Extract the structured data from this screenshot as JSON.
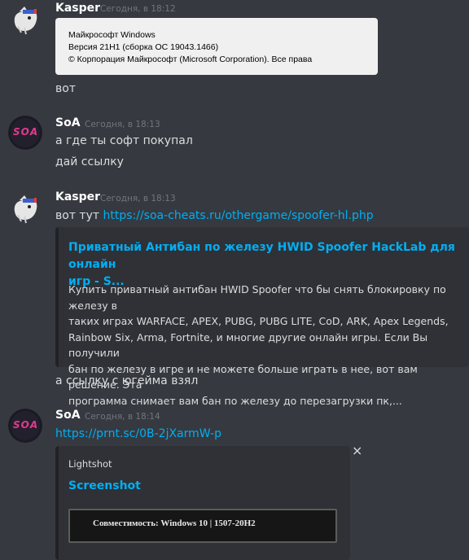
{
  "messages": [
    {
      "author": "Kasper",
      "time": "Сегодня, в 18:12",
      "screenshot_lines": [
        "Майкрософт Windows",
        "Версия 21H1 (сборка ОС 19043.1466)",
        "© Корпорация Майкрософт (Microsoft Corporation). Все права"
      ],
      "text": "вот"
    },
    {
      "author": "SoA",
      "time": "Сегодня, в 18:13",
      "lines": [
        "а где ты софт покупал",
        "дай ссылку"
      ]
    },
    {
      "author": "Kasper",
      "time": "Сегодня, в 18:13",
      "prefix": "вот тут ",
      "link": "https://soa-cheats.ru/othergame/spoofer-hl.php",
      "embed": {
        "title_lines": [
          "Приватный Антибан по железу HWID Spoofer HackLab для онлайн",
          "игр - S..."
        ],
        "description_lines": [
          "Купить приватный антибан HWID Spoofer что бы снять блокировку по железу в",
          "таких играх WARFACE, APEX, PUBG, PUBG LITE, CoD, ARK, Apex Legends,",
          "Rainbow Six, Arma, Fortnite, и многие другие онлайн игры. Если Вы получили",
          "бан по железу в игре и не можете больше играть в нее, вот вам решение. Эта",
          "программа снимает вам бан по железу до перезагрузки пк,..."
        ]
      },
      "followup": "а ссылку с югейма взял"
    },
    {
      "author": "SoA",
      "time": "Сегодня, в 18:14",
      "link": "https://prnt.sc/0B-2jXarmW-p",
      "embed": {
        "provider": "Lightshot",
        "title": "Screenshot",
        "image_text": "Совместимость: Windows 10 | 1507-20H2"
      }
    }
  ],
  "avatar_soa_text": "SOA",
  "icons": {
    "close": "×"
  }
}
